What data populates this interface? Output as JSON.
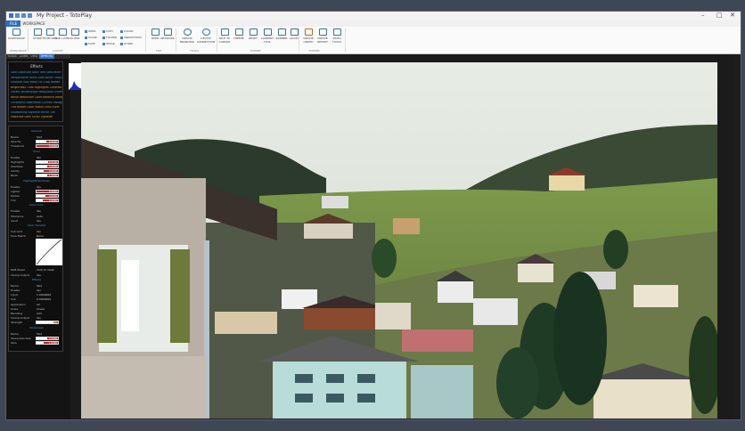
{
  "window": {
    "title": "My Project - TotoPlay"
  },
  "ribbon_tabs": [
    "FILE",
    "WORKSPACE"
  ],
  "ribbon_buttons": [
    {
      "label": "WORKSPACE",
      "icon": "workspace-icon"
    },
    {
      "label": "STORE",
      "icon": "store-icon"
    },
    {
      "label": "FROM WEB",
      "icon": "web-icon"
    },
    {
      "label": "ADD LAYER",
      "icon": "add-layer-icon"
    },
    {
      "label": "IN-ONE",
      "icon": "in-one-icon"
    },
    {
      "label": "OPEN",
      "icon": "open-icon"
    },
    {
      "label": "NETWORK",
      "icon": "network-icon"
    },
    {
      "label": "CREATE BRANDING",
      "icon": "branding-icon"
    },
    {
      "label": "DEVICE CONNECTION",
      "icon": "device-icon"
    },
    {
      "label": "SPLIT BY CURSOR",
      "icon": "split-icon"
    },
    {
      "label": "FREEZE",
      "icon": "freeze-icon"
    },
    {
      "label": "RESET",
      "icon": "reset-icon"
    },
    {
      "label": "CURRENT TOOL",
      "icon": "tool-icon"
    },
    {
      "label": "NUMBER",
      "icon": "number-icon"
    },
    {
      "label": "AUDIO",
      "icon": "audio-icon"
    },
    {
      "label": "CREATE LINKED",
      "icon": "link-icon"
    },
    {
      "label": "CREATE REPORT",
      "icon": "report-icon"
    },
    {
      "label": "VIDEO TOOLS",
      "icon": "video-icon"
    }
  ],
  "ribbon_small": [
    "OPEN",
    "COPY",
    "COLOR",
    "CLOSE",
    "FOLDER",
    "ANNOTATION",
    "SAVE",
    "IMAGE",
    "STORE"
  ],
  "ribbon_groups": [
    "WORKSPACE",
    "LAYOUT",
    "FILE",
    "TOOLS",
    "EXPORT",
    "EXPORT"
  ],
  "panel_tabs": [
    "TOOLS",
    "LAYER",
    "VIEW",
    "EFFECTS"
  ],
  "effects": {
    "heading": "Effects",
    "items": [
      {
        "text": "Gain Exposure Auto Text Saturation",
        "color": "#3aa0e8"
      },
      {
        "text": "Temperature Black Low White Grayscale",
        "color": "#3aa0e8"
      },
      {
        "text": "Sharpen Blur Mask Fill Crop Rotate",
        "color": "#3aa0e8"
      },
      {
        "text": "Brightness Tints Highlights Contrast",
        "color": "#e89a2a"
      },
      {
        "text": "Levels Vectorscope Resolution Invert",
        "color": "#3aa0e8"
      },
      {
        "text": "Noise Reduction Color Balance Warp",
        "color": "#e89a2a"
      },
      {
        "text": "Chromatic Aberration Curves Histogram",
        "color": "#3aa0e8"
      },
      {
        "text": "Tint Bloom Color Match Lens Flare",
        "color": "#e89a2a"
      },
      {
        "text": "Sharpening Vignette Mirror Tile",
        "color": "#3aa0e8"
      },
      {
        "text": "Posterize Lens Scroll Vignette",
        "color": "#e89a2a"
      }
    ]
  },
  "properties": {
    "sections": [
      "General",
      "Color",
      "Highlights/Shadows",
      "Auto Color",
      "Color Transfer",
      "Effects",
      "Sharpness"
    ],
    "rows": [
      {
        "label": "Name",
        "value": "Test"
      },
      {
        "label": "Opacity",
        "slider": 0.45,
        "num": "0.0000"
      },
      {
        "label": "Threshold",
        "slider": 0.0,
        "num": "0.0000"
      },
      {
        "label": "Enable",
        "value": "Yes"
      },
      {
        "label": "Highlights",
        "slider": 0.55,
        "num": "0.0000"
      },
      {
        "label": "Shadows",
        "slider": 0.5,
        "num": "0.0000"
      },
      {
        "label": "Clarity",
        "slider": 0.35,
        "num": "0.0000"
      },
      {
        "label": "Black",
        "slider": 0.5,
        "num": "1.0000"
      },
      {
        "label": "Enable",
        "value": "Yes"
      },
      {
        "label": "Lighter",
        "slider": 0.0,
        "num": "0.0000"
      },
      {
        "label": "Darker",
        "slider": 0.4,
        "num": "0.0000"
      },
      {
        "label": "Tint",
        "slider": 0.3,
        "num": "0.0000"
      },
      {
        "label": "Enable",
        "value": "Yes"
      },
      {
        "label": "Tolerance",
        "value": "Auto"
      },
      {
        "label": "Input",
        "value": "Yes"
      },
      {
        "label": "Sub Grid",
        "value": "Yes"
      },
      {
        "label": "Tone Match",
        "value": "None"
      },
      {
        "label": "RGB Reset",
        "value": "Click to reset"
      },
      {
        "label": "Clamp Output",
        "value": "Yes"
      },
      {
        "label": "Name",
        "value": "Test"
      },
      {
        "label": "Enable",
        "value": "Yes"
      },
      {
        "label": "Input",
        "value": "1.0000000"
      },
      {
        "label": "Sub",
        "value": "0.0000000"
      },
      {
        "label": "Application",
        "value": "All"
      },
      {
        "label": "Scale",
        "value": "Linear"
      },
      {
        "label": "Blending",
        "value": "Add"
      },
      {
        "label": "Clamp Output",
        "value": "Yes"
      },
      {
        "label": "Strength",
        "slider": 0.8,
        "num": "0.0000"
      },
      {
        "label": "Name",
        "value": "Test"
      },
      {
        "label": "Sharpness Size",
        "slider": 0.5,
        "num": "0.0000"
      },
      {
        "label": "Iters",
        "slider": 0.35,
        "num": "1.0000"
      }
    ]
  },
  "colors": {
    "accent": "#2f74c8",
    "slider": "#c02020"
  }
}
